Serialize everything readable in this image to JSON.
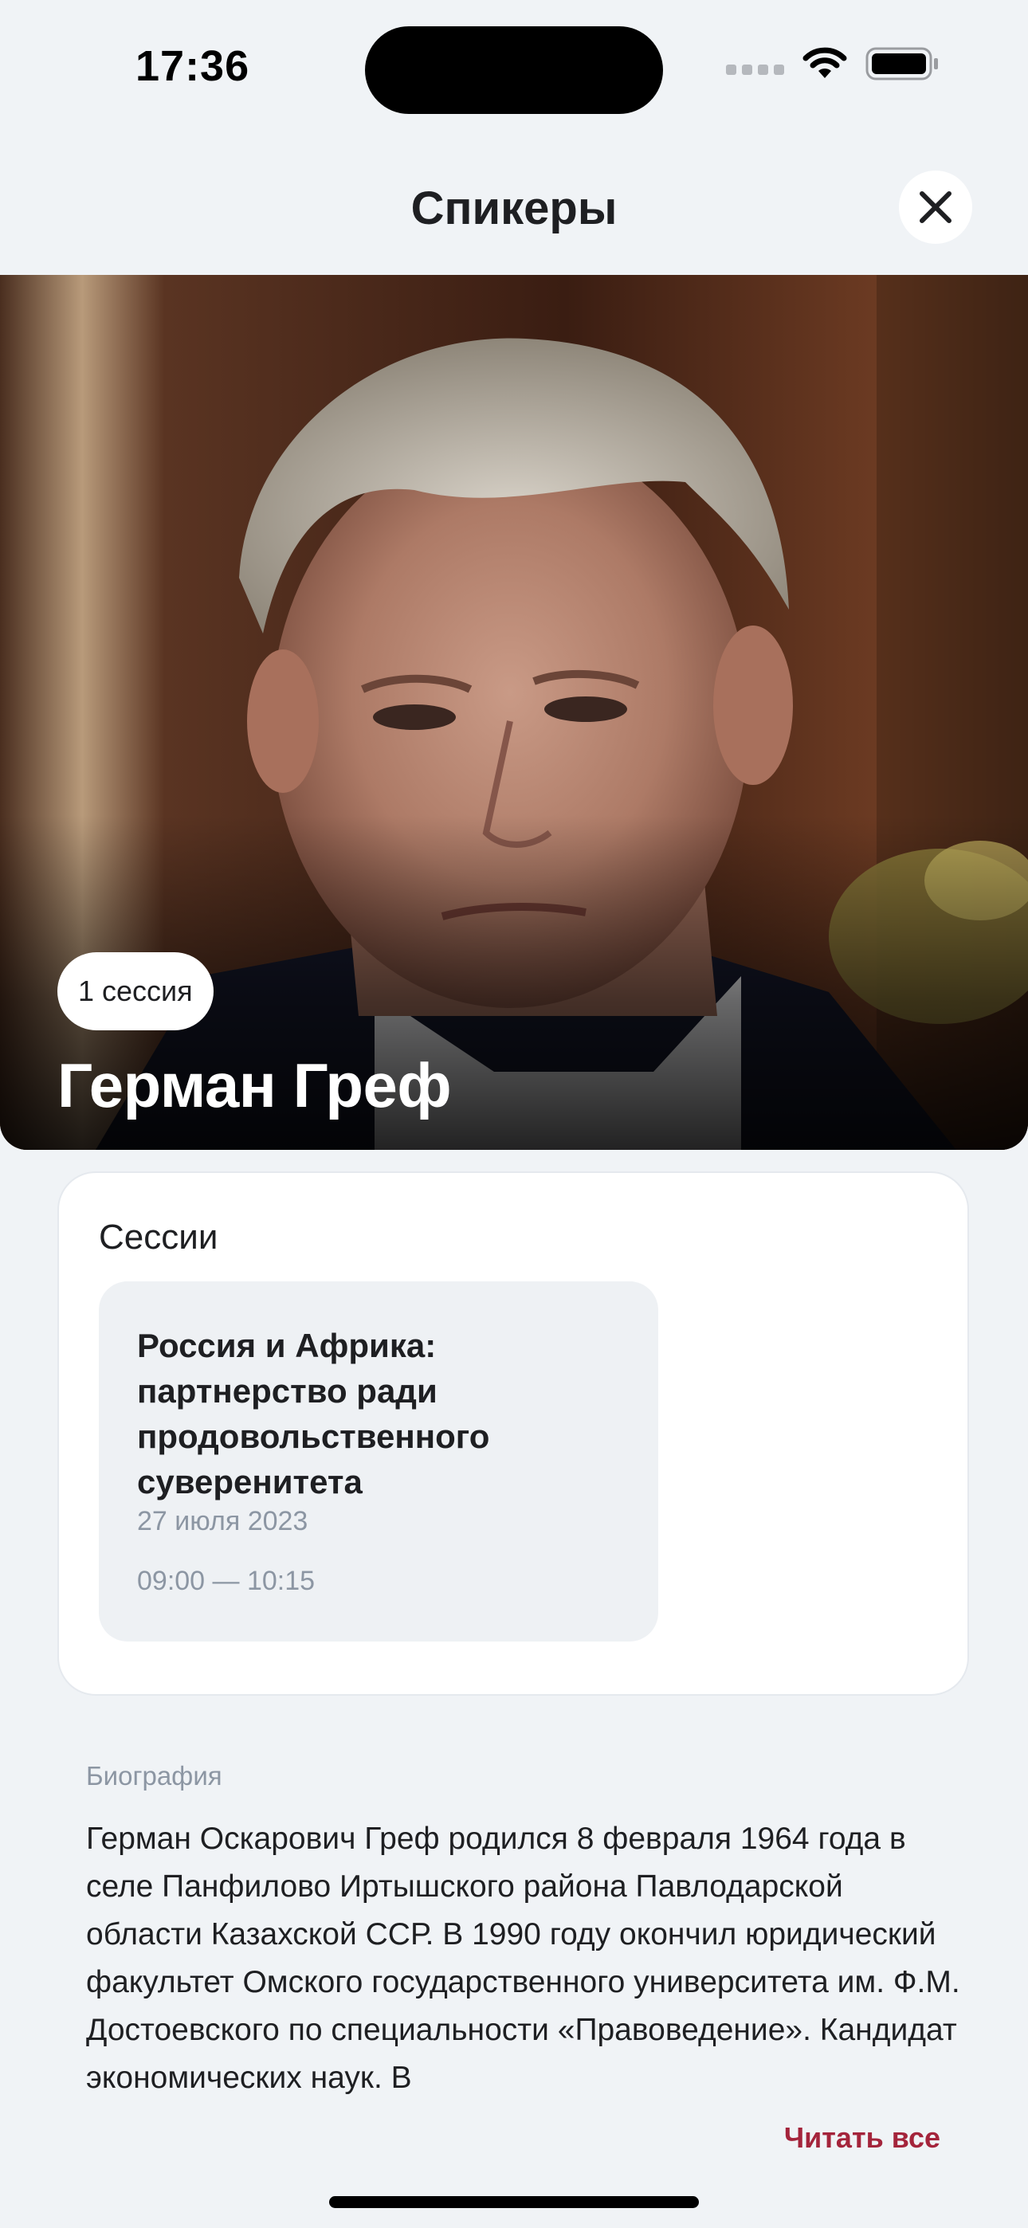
{
  "status_bar": {
    "time": "17:36"
  },
  "header": {
    "title": "Спикеры",
    "close_icon": "close-icon"
  },
  "speaker": {
    "sessions_badge": "1 сессия",
    "name": "Герман Греф"
  },
  "sessions": {
    "title": "Сессии",
    "items": [
      {
        "title": "Россия и Африка: партнерство ради продовольственного суверенитета",
        "date": "27 июля 2023",
        "time": "09:00 — 10:15"
      }
    ]
  },
  "biography": {
    "label": "Биография",
    "text": "Герман Оскарович Греф родился 8 февраля 1964 года в селе Панфилово Иртышского района Павлодарской области Казахской ССР. В 1990 году окончил юридический факультет Омского государственного университета им. Ф.М. Достоевского по специальности «Правоведение». Кандидат экономических наук. В",
    "read_all": "Читать все"
  },
  "colors": {
    "background": "#f0f3f6",
    "accent": "#a4243b",
    "muted_text": "#8c96a3"
  }
}
